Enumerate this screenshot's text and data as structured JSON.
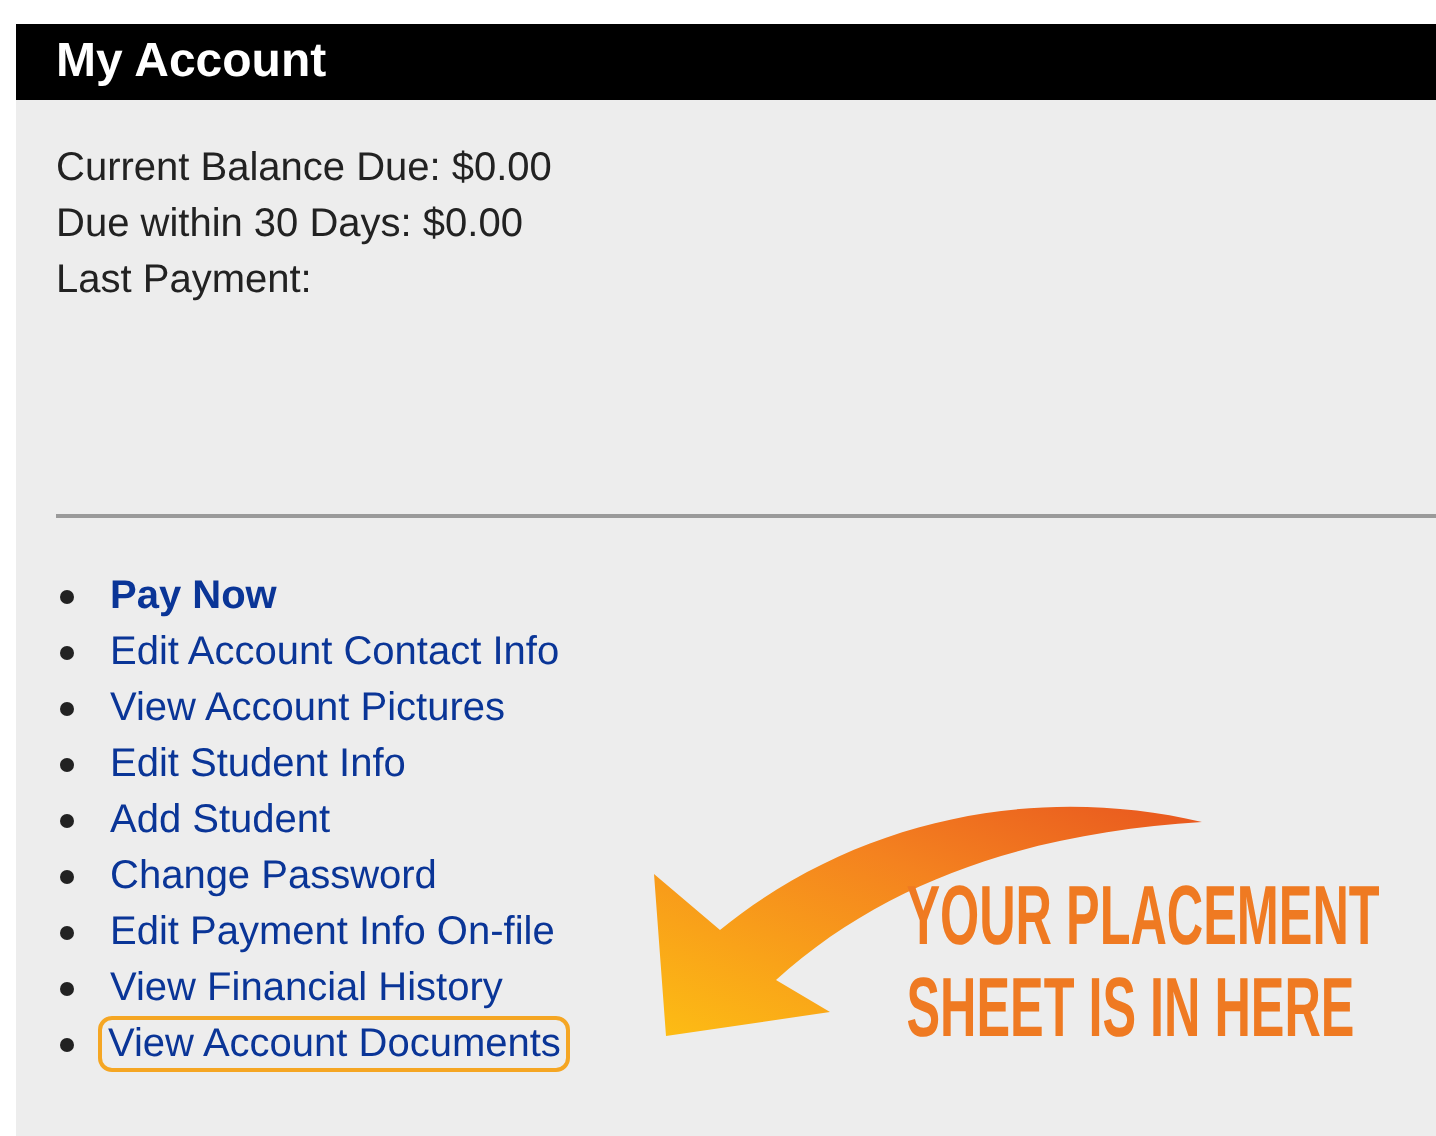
{
  "header": {
    "title": "My Account"
  },
  "balances": [
    "Current Balance Due: $0.00",
    "Due within 30 Days: $0.00",
    "Last Payment:"
  ],
  "links": [
    {
      "label": "Pay Now",
      "kind": "primary",
      "highlighted": false
    },
    {
      "label": "Edit Account Contact Info",
      "kind": "link",
      "highlighted": false
    },
    {
      "label": "View Account Pictures",
      "kind": "link",
      "highlighted": false
    },
    {
      "label": "Edit Student Info",
      "kind": "link",
      "highlighted": false
    },
    {
      "label": "Add Student",
      "kind": "link",
      "highlighted": false
    },
    {
      "label": "Change Password",
      "kind": "link",
      "highlighted": false
    },
    {
      "label": "Edit Payment Info On-file",
      "kind": "link",
      "highlighted": false
    },
    {
      "label": "View Financial History",
      "kind": "link",
      "highlighted": false
    },
    {
      "label": "View Account Documents",
      "kind": "link",
      "highlighted": true
    }
  ],
  "annotation": {
    "lines": [
      "YOUR PLACEMENT",
      "SHEET IS IN HERE"
    ]
  }
}
